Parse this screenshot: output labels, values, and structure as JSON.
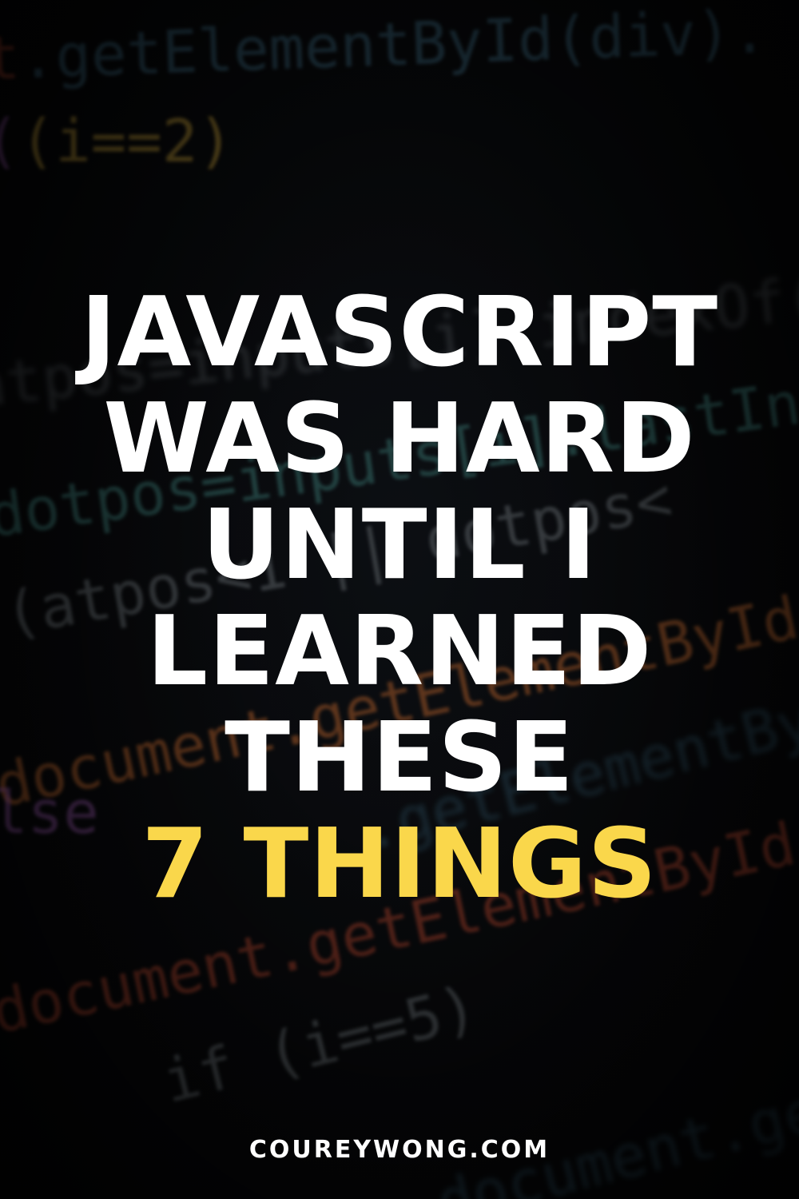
{
  "headline": {
    "line1": "JAVASCRIPT",
    "line2": "WAS HARD",
    "line3": "UNTIL I",
    "line4": "LEARNED",
    "line5": "THESE",
    "line6": "7 THINGS",
    "accent_color": "#fad74b",
    "text_color": "#ffffff"
  },
  "footer": {
    "site": "COUREYWONG.COM"
  },
  "background": {
    "code_snippets": [
      ".getElementById(div).",
      "(i==2)",
      "atpos=inputs[i].indexOf(\"@\");",
      "dotpos=inputs[i].lastIndexOf(",
      "(atpos<1 || dotpos<",
      "document.getElementById('errEmai",
      ".getElementById(div).",
      "lse",
      "document.getElementById(",
      "if (i==5)",
      "document.getE"
    ]
  }
}
